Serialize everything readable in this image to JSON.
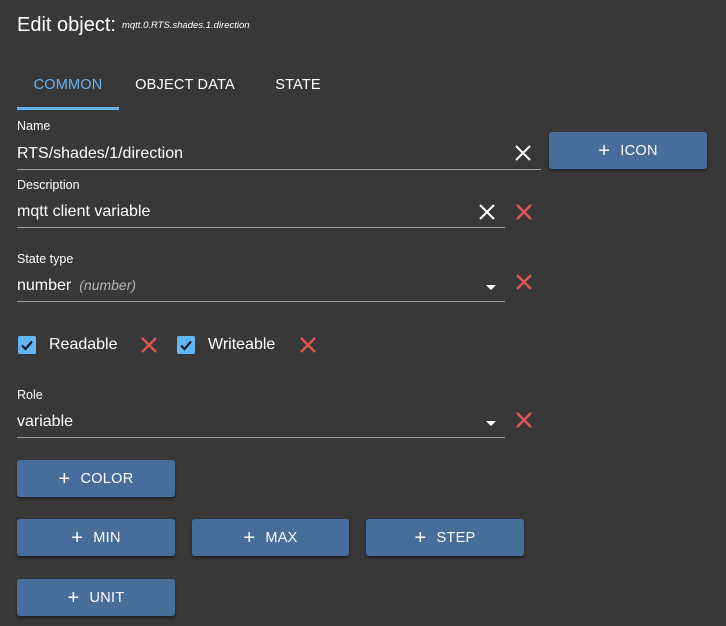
{
  "header": {
    "title": "Edit object:",
    "object_id": "mqtt.0.RTS.shades.1.direction"
  },
  "tabs": [
    {
      "label": "COMMON",
      "active": true
    },
    {
      "label": "OBJECT DATA",
      "active": false
    },
    {
      "label": "STATE",
      "active": false
    }
  ],
  "form": {
    "name": {
      "label": "Name",
      "value": "RTS/shades/1/direction"
    },
    "description": {
      "label": "Description",
      "value": "mqtt client variable"
    },
    "state_type": {
      "label": "State type",
      "value": "number",
      "hint": "(number)"
    },
    "readable": {
      "label": "Readable",
      "checked": true
    },
    "writeable": {
      "label": "Writeable",
      "checked": true
    },
    "role": {
      "label": "Role",
      "value": "variable"
    }
  },
  "buttons": {
    "icon": "ICON",
    "color": "COLOR",
    "min": "MIN",
    "max": "MAX",
    "step": "STEP",
    "unit": "UNIT",
    "plus": "+"
  },
  "icons": {
    "clear": "close-icon",
    "remove": "red-x-icon",
    "dropdown": "caret-down-icon",
    "checked": "checkbox-checked-icon"
  },
  "colors": {
    "background": "#383838",
    "accent": "#64b5f6",
    "button": "#476d9b",
    "remove": "#e05454"
  }
}
